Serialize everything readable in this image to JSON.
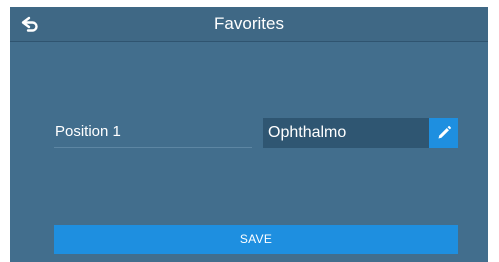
{
  "header": {
    "title": "Favorites",
    "back_icon": "back-arrow-icon"
  },
  "form": {
    "position_label": "Position 1",
    "program_value": "Ophthalmo",
    "edit_icon": "pencil-icon"
  },
  "footer": {
    "save_label": "SAVE"
  },
  "colors": {
    "background": "#426e8d",
    "header": "#3f6885",
    "field": "#2f5672",
    "accent": "#1e8fe0",
    "text": "#ffffff"
  }
}
